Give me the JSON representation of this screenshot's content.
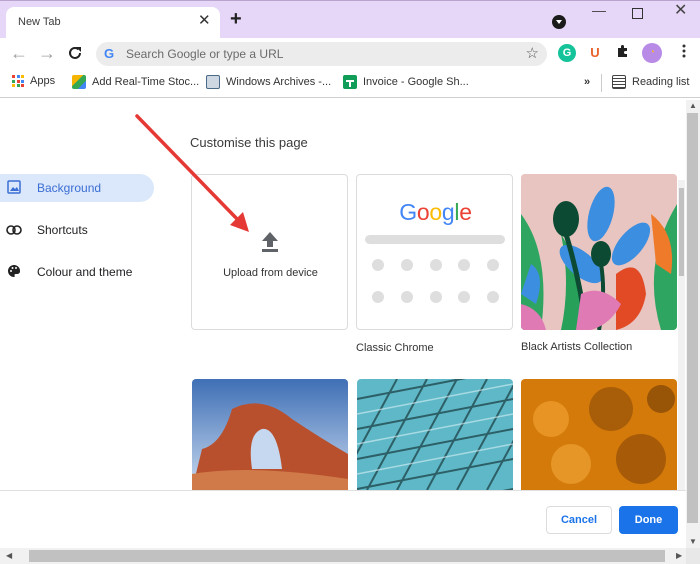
{
  "window": {
    "tab_title": "New Tab",
    "tab_close_glyph": "✕",
    "new_tab_glyph": "+",
    "minimize_glyph": "—",
    "close_glyph": "✕"
  },
  "toolbar": {
    "back_glyph": "←",
    "forward_glyph": "→",
    "reload_glyph": "C",
    "omnibox_placeholder": "Search Google or type a URL",
    "omnibox_value": "",
    "g_glyph": "G",
    "star_glyph": "☆",
    "extensions": [
      {
        "name": "grammarly",
        "glyph": "G",
        "color": "#15c39a"
      },
      {
        "name": "u-extension",
        "glyph": "U",
        "color": "#e9622a"
      },
      {
        "name": "extensions-puzzle",
        "glyph": "✱"
      }
    ],
    "menu_glyph": "⋮"
  },
  "bookmarks": {
    "items": [
      {
        "label": "Apps"
      },
      {
        "label": "Add Real-Time Stoc..."
      },
      {
        "label": "Windows Archives -..."
      },
      {
        "label": "Invoice - Google Sh..."
      }
    ],
    "more_glyph": "»",
    "reading_list": "Reading list"
  },
  "sidebar": {
    "items": [
      {
        "label": "Background",
        "icon": "image-icon",
        "selected": true
      },
      {
        "label": "Shortcuts",
        "icon": "link-icon",
        "selected": false
      },
      {
        "label": "Colour and theme",
        "icon": "palette-icon",
        "selected": false
      }
    ]
  },
  "main": {
    "title": "Customise this page",
    "upload_label": "Upload from device",
    "google_logo": [
      "G",
      "o",
      "o",
      "g",
      "l",
      "e"
    ],
    "google_colors": [
      "#4285f4",
      "#ea4335",
      "#fbbc05",
      "#4285f4",
      "#34a853",
      "#ea4335"
    ],
    "tiles": [
      {
        "caption": "Classic Chrome"
      },
      {
        "caption": "Black Artists Collection"
      },
      {
        "caption": ""
      },
      {
        "caption": ""
      },
      {
        "caption": ""
      }
    ]
  },
  "footer": {
    "cancel_label": "Cancel",
    "done_label": "Done"
  },
  "colors": {
    "accent": "#1a73e8",
    "titlebar": "#e6d6f7",
    "selected_sidebar": "#dbe7fb",
    "annotation_arrow": "#e53935"
  }
}
